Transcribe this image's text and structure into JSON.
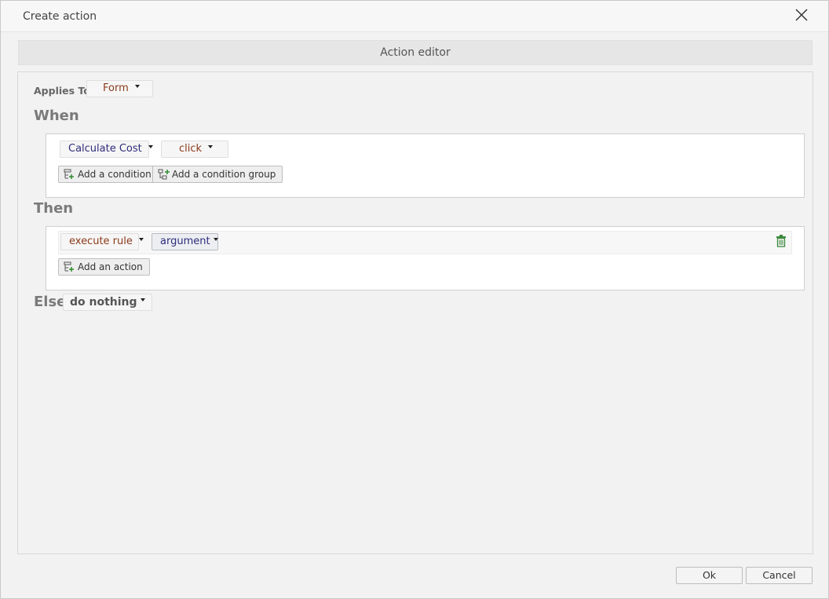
{
  "dialog": {
    "title": "Create action",
    "close_icon": "close-icon"
  },
  "editor": {
    "header": "Action editor",
    "applies_to": {
      "label": "Applies To",
      "value": "Form"
    },
    "when": {
      "title": "When",
      "control": "Calculate Cost",
      "event": "click",
      "add_condition_label": "Add a condition",
      "add_condition_group_label": "Add a condition group"
    },
    "then": {
      "title": "Then",
      "action": "execute rule",
      "argument": "argument",
      "add_action_label": "Add an action",
      "delete_icon": "trash-icon"
    },
    "else": {
      "title": "Else",
      "value": "do nothing"
    }
  },
  "footer": {
    "ok_label": "Ok",
    "cancel_label": "Cancel"
  },
  "colors": {
    "control_text": "#2d2d7a",
    "event_text": "#8b3a1a",
    "section_title": "#7a7a7a",
    "trash_green": "#3c8a3c"
  }
}
